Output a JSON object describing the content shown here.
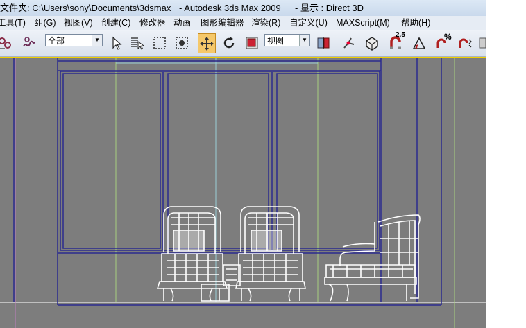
{
  "window": {
    "title_path": "文件夹: C:\\Users\\sony\\Documents\\3dsmax",
    "title_app": "- Autodesk 3ds Max  2009",
    "title_display": "- 显示 : Direct 3D"
  },
  "menu": {
    "items": [
      "工具(T)",
      "组(G)",
      "视图(V)",
      "创建(C)",
      "修改器",
      "动画",
      "图形编辑器",
      "渲染(R)",
      "自定义(U)",
      "MAXScript(M)",
      "帮助(H)"
    ]
  },
  "toolbar": {
    "selection_filter": "全部",
    "coord_system": "视图",
    "angle_snap_label": "2.5",
    "percent_snap_label": "%",
    "icons": [
      "link-icon",
      "bind-space-warp-icon",
      "select-icon",
      "select-by-name-icon",
      "rectangular-selection-icon",
      "window-crossing-icon",
      "move-icon",
      "rotate-icon",
      "scale-icon",
      "pivot-center-icon",
      "manipulate-icon",
      "keyboard-shortcut-icon",
      "snap-toggle-icon",
      "angle-snap-icon",
      "percent-snap-icon",
      "spinner-snap-icon"
    ]
  },
  "viewport": {
    "name": "front-viewport",
    "background_color": "#7d7d7d",
    "wireframe_color": "#ffffff",
    "frame_color": "#2b2b8f",
    "active_border_color": "#f0d000"
  }
}
